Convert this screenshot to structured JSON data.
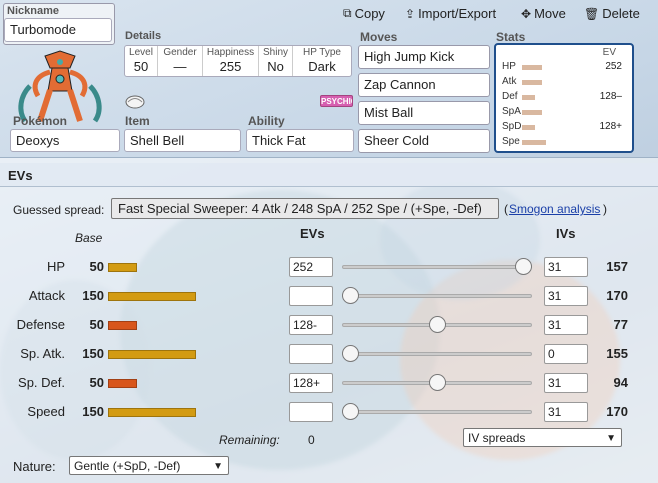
{
  "toolbar": {
    "copy_label": "Copy",
    "import_export_label": "Import/Export",
    "move_label": "Move",
    "delete_label": "Delete"
  },
  "nickname": {
    "label": "Nickname",
    "value": "Turbomode"
  },
  "details": {
    "title": "Details",
    "level": {
      "label": "Level",
      "value": "50"
    },
    "gender": {
      "label": "Gender",
      "value": "—"
    },
    "happiness": {
      "label": "Happiness",
      "value": "255"
    },
    "shiny": {
      "label": "Shiny",
      "value": "No"
    },
    "hp_type": {
      "label": "HP Type",
      "value": "Dark"
    }
  },
  "type_badge": "PSYCHIC",
  "pokemon": {
    "label": "Pokémon",
    "value": "Deoxys"
  },
  "item": {
    "label": "Item",
    "value": "Shell Bell"
  },
  "ability": {
    "label": "Ability",
    "value": "Thick Fat"
  },
  "moves": {
    "title": "Moves",
    "list": [
      "High Jump Kick",
      "Zap Cannon",
      "Mist Ball",
      "Sheer Cold"
    ]
  },
  "stats_box": {
    "title": "Stats",
    "ev_header": "EV",
    "rows": [
      {
        "name": "HP",
        "ev": "252",
        "bar": 0.45
      },
      {
        "name": "Atk",
        "ev": "",
        "bar": 0.45
      },
      {
        "name": "Def",
        "ev": "128–",
        "bar": 0.3
      },
      {
        "name": "SpA",
        "ev": "",
        "bar": 0.45
      },
      {
        "name": "SpD",
        "ev": "128+",
        "bar": 0.3
      },
      {
        "name": "Spe",
        "ev": "",
        "bar": 0.55
      }
    ]
  },
  "evs_panel": {
    "title": "EVs",
    "guessed_label": "Guessed spread:",
    "guessed_value": "Fast Special Sweeper: 4 Atk / 248 SpA / 252 Spe / (+Spe, -Def)",
    "paren_open": "(",
    "smogon_link": "Smogon analysis",
    "paren_close": ")",
    "col_base": "Base",
    "col_evs": "EVs",
    "col_ivs": "IVs",
    "rows": [
      {
        "name": "HP",
        "base": "50",
        "base_value": 50,
        "color": "#d39b12",
        "ev": "252",
        "slider": 1.0,
        "iv": "31",
        "total": "157"
      },
      {
        "name": "Attack",
        "base": "150",
        "base_value": 150,
        "color": "#d39b12",
        "ev": "",
        "slider": 0.0,
        "iv": "31",
        "total": "170"
      },
      {
        "name": "Defense",
        "base": "50",
        "base_value": 50,
        "color": "#d8561c",
        "ev": "128-",
        "slider": 0.5,
        "iv": "31",
        "total": "77"
      },
      {
        "name": "Sp. Atk.",
        "base": "150",
        "base_value": 150,
        "color": "#d39b12",
        "ev": "",
        "slider": 0.0,
        "iv": "0",
        "total": "155"
      },
      {
        "name": "Sp. Def.",
        "base": "50",
        "base_value": 50,
        "color": "#d8561c",
        "ev": "128+",
        "slider": 0.5,
        "iv": "31",
        "total": "94"
      },
      {
        "name": "Speed",
        "base": "150",
        "base_value": 150,
        "color": "#d39b12",
        "ev": "",
        "slider": 0.0,
        "iv": "31",
        "total": "170"
      }
    ],
    "remaining_label": "Remaining:",
    "remaining_value": "0",
    "iv_spreads": "IV spreads",
    "nature_label": "Nature:",
    "nature_value": "Gentle (+SpD, -Def)"
  },
  "colors": {
    "stats_border": "#1f4f8c",
    "bar_neutral": "#d39b12",
    "bar_minus": "#d8561c",
    "psychic": "#d65fb0"
  }
}
